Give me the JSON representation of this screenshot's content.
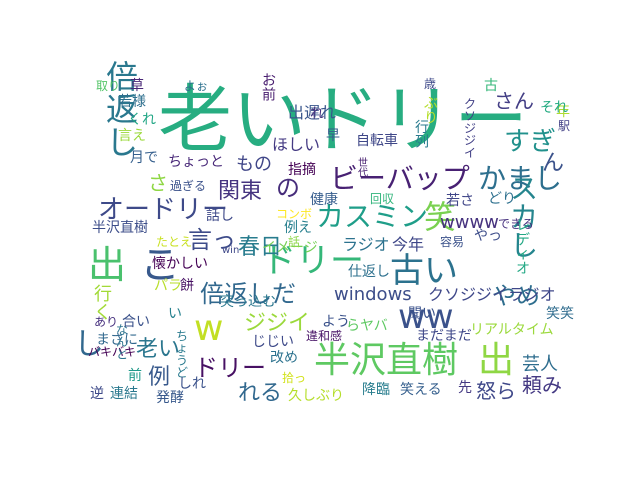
{
  "words": [
    {
      "text": "老いドリー",
      "color": "#27ad81"
    },
    {
      "text": "半沢直樹",
      "color": "#5ec962"
    },
    {
      "text": "出",
      "color": "#8fd744"
    },
    {
      "text": "倍返し",
      "color": "#2a788e"
    },
    {
      "text": "ビーバップ",
      "color": "#482173"
    },
    {
      "text": "かまし",
      "color": "#2d6f8e"
    },
    {
      "text": "ドリー",
      "color": "#35b779"
    },
    {
      "text": "古い",
      "color": "#2c728e"
    },
    {
      "text": "笑",
      "color": "#7ad151"
    },
    {
      "text": "出",
      "color": "#4ac16d"
    },
    {
      "text": "こ",
      "color": "#38598c"
    },
    {
      "text": "オードリー",
      "color": "#3e4a89"
    },
    {
      "text": "カスミン",
      "color": "#1f9e89"
    },
    {
      "text": "ww",
      "color": "#3b528b"
    },
    {
      "text": "w",
      "color": "#c2df23"
    },
    {
      "text": "倍返しだ",
      "color": "#31688e"
    },
    {
      "text": "さん",
      "color": "#433e85"
    },
    {
      "text": "すぎ",
      "color": "#21918c"
    },
    {
      "text": "やめ",
      "color": "#2e6e8e"
    },
    {
      "text": "スカし",
      "color": "#25858e"
    },
    {
      "text": "ん",
      "color": "#3b528b"
    },
    {
      "text": "の",
      "color": "#472d7b"
    },
    {
      "text": "もの",
      "color": "#404688"
    },
    {
      "text": "関東",
      "color": "#463480"
    },
    {
      "text": "春日",
      "color": "#287c8e"
    },
    {
      "text": "言っ",
      "color": "#3e4c8a"
    },
    {
      "text": "wwww",
      "color": "#46327e"
    },
    {
      "text": "windows",
      "color": "#3d4e8a"
    },
    {
      "text": "ジジイ",
      "color": "#9bd93c"
    },
    {
      "text": "ドリー",
      "color": "#471063"
    },
    {
      "text": "老い",
      "color": "#2a768e"
    },
    {
      "text": "れる",
      "color": "#31688e"
    },
    {
      "text": "芸人",
      "color": "#2e6d8e"
    },
    {
      "text": "頼み",
      "color": "#443983"
    },
    {
      "text": "怒ら",
      "color": "#3f4889"
    },
    {
      "text": "例",
      "color": "#38598c"
    },
    {
      "text": "前",
      "color": "#1f9a8a"
    },
    {
      "text": "し",
      "color": "#31688e"
    },
    {
      "text": "行く",
      "color": "#a2da37"
    },
    {
      "text": "さ",
      "color": "#8fd744"
    },
    {
      "text": "ちょっと",
      "color": "#482878"
    },
    {
      "text": "過ぎる",
      "color": "#3b528b"
    },
    {
      "text": "健康",
      "color": "#365d8d"
    },
    {
      "text": "回収",
      "color": "#31b57b"
    },
    {
      "text": "若さ",
      "color": "#404688"
    },
    {
      "text": "どり",
      "color": "#2d708e"
    },
    {
      "text": "指摘",
      "color": "#440154"
    },
    {
      "text": "自転車",
      "color": "#3f4788"
    },
    {
      "text": "世代",
      "color": "#482071"
    },
    {
      "text": "出遅れ",
      "color": "#39568c"
    },
    {
      "text": "ほしい",
      "color": "#443a83"
    },
    {
      "text": "れ",
      "color": "#46337f"
    },
    {
      "text": "早",
      "color": "#365c8d"
    },
    {
      "text": "お前",
      "color": "#481d6f"
    },
    {
      "text": "行列",
      "color": "#297b8e"
    },
    {
      "text": "ぶり",
      "color": "#b5de2b"
    },
    {
      "text": "歳",
      "color": "#3e4989"
    },
    {
      "text": "古",
      "color": "#35b779"
    },
    {
      "text": "年",
      "color": "#addc30"
    },
    {
      "text": "それ",
      "color": "#25ab82"
    },
    {
      "text": "駅",
      "color": "#424086"
    },
    {
      "text": "クソジジイ",
      "color": "#424086"
    },
    {
      "text": "よぉ",
      "color": "#2d718e"
    },
    {
      "text": "取り",
      "color": "#54c568"
    },
    {
      "text": "草",
      "color": "#482576"
    },
    {
      "text": "若様",
      "color": "#2e6f8e"
    },
    {
      "text": "くれ",
      "color": "#21a685"
    },
    {
      "text": "言え",
      "color": "#9bd93c"
    },
    {
      "text": "月で",
      "color": "#355f8d"
    },
    {
      "text": "コンボ",
      "color": "#fde725"
    },
    {
      "text": "話し",
      "color": "#3e4989"
    },
    {
      "text": "例え",
      "color": "#277f8e"
    },
    {
      "text": "イメージ",
      "color": "#75d054"
    },
    {
      "text": "話",
      "color": "#8bd646"
    },
    {
      "text": "ラジオ",
      "color": "#2c728e"
    },
    {
      "text": "今年",
      "color": "#3f4788"
    },
    {
      "text": "容易",
      "color": "#3b528b"
    },
    {
      "text": "できる",
      "color": "#46307e"
    },
    {
      "text": "やっ",
      "color": "#3d4d8a"
    },
    {
      "text": "レディオ",
      "color": "#22a884"
    },
    {
      "text": "半沢直樹",
      "color": "#3d4e8a"
    },
    {
      "text": "たとえ",
      "color": "#c8e020"
    },
    {
      "text": "win",
      "color": "#3f4889"
    },
    {
      "text": "懐かしい",
      "color": "#440154"
    },
    {
      "text": "仕返し",
      "color": "#2d708e"
    },
    {
      "text": "クソジジイラジオ",
      "color": "#3f4889"
    },
    {
      "text": "パラ",
      "color": "#b8de29"
    },
    {
      "text": "餅",
      "color": "#471063"
    },
    {
      "text": "突っ込む",
      "color": "#2a778e"
    },
    {
      "text": "聞い",
      "color": "#3b528b"
    },
    {
      "text": "笑笑",
      "color": "#2f6c8e"
    },
    {
      "text": "あり",
      "color": "#46307e"
    },
    {
      "text": "合い",
      "color": "#3b528b"
    },
    {
      "text": "い",
      "color": "#26818e"
    },
    {
      "text": "よう",
      "color": "#3b528b"
    },
    {
      "text": "らヤバ",
      "color": "#5ec962"
    },
    {
      "text": "リアルタイム",
      "color": "#9bd93c"
    },
    {
      "text": "まさに",
      "color": "#31688e"
    },
    {
      "text": "バキバキ",
      "color": "#440154"
    },
    {
      "text": "なんと",
      "color": "#2c738e"
    },
    {
      "text": "ちょうど",
      "color": "#297a8e"
    },
    {
      "text": "違和感",
      "color": "#481467"
    },
    {
      "text": "まだまだ",
      "color": "#3f4889"
    },
    {
      "text": "じじい",
      "color": "#3e4a89"
    },
    {
      "text": "改め",
      "color": "#2c728e"
    },
    {
      "text": "しれ",
      "color": "#3b528b"
    },
    {
      "text": "拾っ",
      "color": "#d2e21b"
    },
    {
      "text": "降臨",
      "color": "#287d8e"
    },
    {
      "text": "笑える",
      "color": "#355f8d"
    },
    {
      "text": "先",
      "color": "#443983"
    },
    {
      "text": "逆",
      "color": "#3e4a89"
    },
    {
      "text": "連結",
      "color": "#2a788e"
    },
    {
      "text": "発酵",
      "color": "#38598c"
    },
    {
      "text": "久しぶり",
      "color": "#b5de2b"
    }
  ]
}
